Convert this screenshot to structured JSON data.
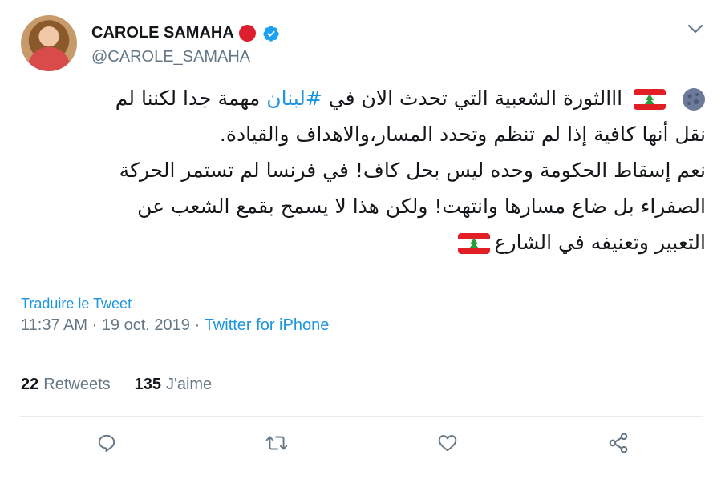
{
  "user": {
    "display_name": "CAROLE SAMAHA",
    "handle": "@CAROLE_SAMAHA",
    "avatar_icon": "profile-photo",
    "verified_icon": "verified-badge-icon",
    "status_emoji": "red-circle"
  },
  "tweet": {
    "lines": [
      {
        "before": "ااالثورة الشعبية التي تحدث الان في ",
        "hashtag": "#لبنان",
        "after": "  مهمة جدا لكننا لم"
      },
      {
        "text": "نقل أنها كافية إذا لم تنظم وتحدد المسار،والاهداف والقيادة."
      },
      {
        "text": "نعم إسقاط الحكومة وحده ليس بحل كاف! في فرنسا لم تستمر الحركة"
      },
      {
        "text": "الصفراء بل ضاع مسارها وانتهت! ولكن هذا لا يسمح  بقمع الشعب عن"
      },
      {
        "text": "التعبير وتعنيفه في الشارع"
      }
    ]
  },
  "translate_label": "Traduire le Tweet",
  "meta": {
    "time": "11:37 AM",
    "sep": " · ",
    "date": "19 oct. 2019",
    "source": "Twitter for iPhone"
  },
  "stats": {
    "retweets_count": "22",
    "retweets_label": "Retweets",
    "likes_count": "135",
    "likes_label": "J'aime"
  },
  "colors": {
    "link": "#1b95e0",
    "muted": "#657786",
    "text": "#14171a",
    "flag_red": "#e31f26",
    "cedar_green": "#2a9d3a"
  }
}
